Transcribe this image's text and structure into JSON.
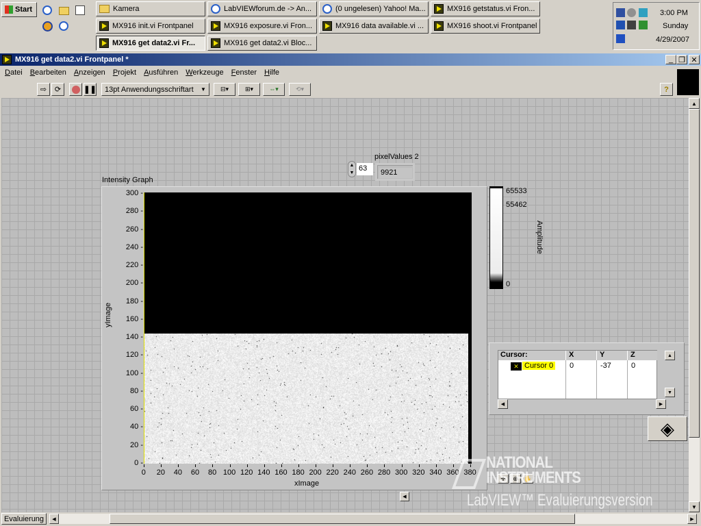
{
  "taskbar": {
    "start": "Start",
    "buttons": [
      "Kamera",
      "LabVIEWforum.de -> An...",
      "(0 ungelesen) Yahoo! Ma...",
      "MX916 getstatus.vi Fron...",
      "MX916 init.vi Frontpanel",
      "MX916 exposure.vi Fron...",
      "MX916 data available.vi ...",
      "MX916 shoot.vi Frontpanel",
      "MX916 get data2.vi Fr...",
      "MX916 get data2.vi Bloc..."
    ],
    "clock": {
      "time": "3:00 PM",
      "day": "Sunday",
      "date": "4/29/2007"
    }
  },
  "window": {
    "title": "MX916 get data2.vi Frontpanel *"
  },
  "menu": [
    "Datei",
    "Bearbeiten",
    "Anzeigen",
    "Projekt",
    "Ausführen",
    "Werkzeuge",
    "Fenster",
    "Hilfe"
  ],
  "toolbar": {
    "font": "13pt Anwendungsschriftart",
    "help": "?"
  },
  "index": {
    "value": "63"
  },
  "pixel_values": {
    "label": "pixelValues 2",
    "value": "9921"
  },
  "graph": {
    "label": "Intensity Graph",
    "chart_data": {
      "type": "heatmap",
      "xlabel": "xImage",
      "ylabel": "yImage",
      "xlim": [
        0,
        380
      ],
      "ylim": [
        0,
        300
      ],
      "x_ticks": [
        "0",
        "20",
        "40",
        "60",
        "80",
        "100",
        "120",
        "140",
        "160",
        "180",
        "200",
        "220",
        "240",
        "260",
        "280",
        "300",
        "320",
        "340",
        "360",
        "380"
      ],
      "y_ticks": [
        "0",
        "20",
        "40",
        "60",
        "80",
        "100",
        "120",
        "140",
        "160",
        "180",
        "200",
        "220",
        "240",
        "260",
        "280",
        "300"
      ],
      "data_extent": {
        "x": [
          0,
          377
        ],
        "y": [
          0,
          145
        ]
      },
      "colorbar": {
        "label": "Amplitude",
        "ticks": [
          "65533",
          "55462",
          "0"
        ],
        "range": [
          0,
          65533
        ]
      }
    }
  },
  "cursor": {
    "headers": [
      "Cursor:",
      "X",
      "Y",
      "Z"
    ],
    "rows": [
      {
        "name": "Cursor 0",
        "x": "0",
        "y": "-37",
        "z": "0"
      }
    ]
  },
  "watermark": {
    "line1": "NATIONAL",
    "line2": "INSTRUMENTS",
    "line3": "LabVIEW™ Evaluierungsversion"
  },
  "status": {
    "label": "Evaluierung"
  }
}
